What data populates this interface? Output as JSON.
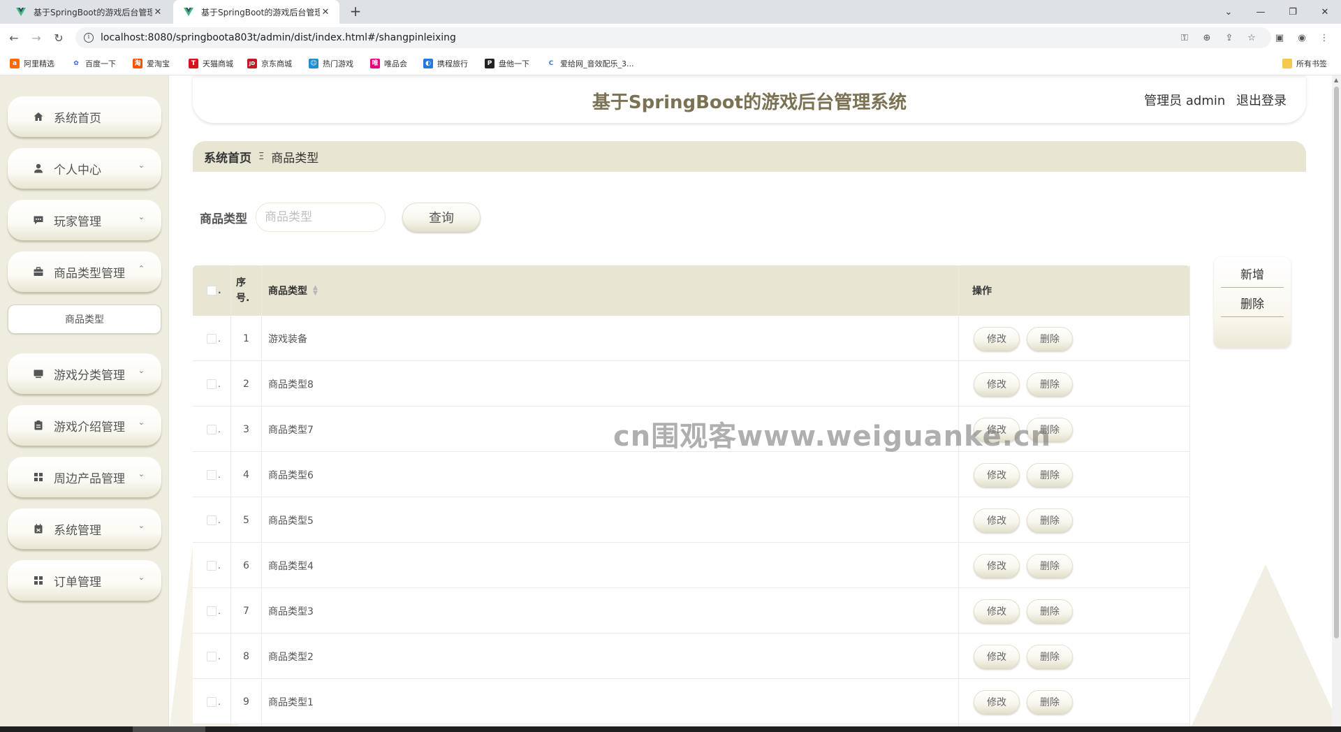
{
  "browser": {
    "tabs": [
      {
        "title": "基于SpringBoot的游戏后台管理",
        "active": false
      },
      {
        "title": "基于SpringBoot的游戏后台管理",
        "active": true
      }
    ],
    "url": "localhost:8080/springboota803t/admin/dist/index.html#/shangpinleixing",
    "bookmarks": [
      {
        "label": "阿里精选",
        "color": "#ff6a00",
        "glyph": "a"
      },
      {
        "label": "百度一下",
        "color": "#2e61d8",
        "glyph": "✿"
      },
      {
        "label": "爱淘宝",
        "color": "#ff5000",
        "glyph": "淘"
      },
      {
        "label": "天猫商城",
        "color": "#d8151a",
        "glyph": "T"
      },
      {
        "label": "京东商城",
        "color": "#c91623",
        "glyph": "JD"
      },
      {
        "label": "热门游戏",
        "color": "#1a8fd6",
        "glyph": "☺"
      },
      {
        "label": "唯品会",
        "color": "#e6007e",
        "glyph": "唯"
      },
      {
        "label": "携程旅行",
        "color": "#2577e3",
        "glyph": "◐"
      },
      {
        "label": "盘他一下",
        "color": "#222222",
        "glyph": "P"
      },
      {
        "label": "爱给网_音效配乐_3...",
        "color": "#2d7be5",
        "glyph": "C"
      }
    ],
    "all_bookmarks": "所有书签"
  },
  "sidebar": {
    "items": [
      {
        "label": "系统首页",
        "icon": "home-icon",
        "arrow": ""
      },
      {
        "label": "个人中心",
        "icon": "user-icon",
        "arrow": "⌄"
      },
      {
        "label": "玩家管理",
        "icon": "chat-icon",
        "arrow": "⌄"
      },
      {
        "label": "商品类型管理",
        "icon": "briefcase-icon",
        "arrow": "⌃"
      },
      {
        "label": "游戏分类管理",
        "icon": "monitor-icon",
        "arrow": "⌄"
      },
      {
        "label": "游戏介绍管理",
        "icon": "clipboard-icon",
        "arrow": "⌄"
      },
      {
        "label": "周边产品管理",
        "icon": "grid-icon",
        "arrow": "⌄"
      },
      {
        "label": "系统管理",
        "icon": "calendar-icon",
        "arrow": "⌄"
      },
      {
        "label": "订单管理",
        "icon": "grid-icon",
        "arrow": "⌄"
      }
    ],
    "subitem": "商品类型"
  },
  "header": {
    "title": "基于SpringBoot的游戏后台管理系统",
    "user": "管理员 admin",
    "logout": "退出登录"
  },
  "breadcrumb": {
    "home": "系统首页",
    "separator": "Ξ",
    "current": "商品类型"
  },
  "search": {
    "label": "商品类型",
    "placeholder": "商品类型",
    "button": "查询"
  },
  "actions": {
    "add": "新增",
    "delete": "删除"
  },
  "table": {
    "headers": {
      "index": "序号.",
      "type": "商品类型",
      "ops": "操作"
    },
    "rows": [
      {
        "index": "1",
        "type": "游戏装备"
      },
      {
        "index": "2",
        "type": "商品类型8"
      },
      {
        "index": "3",
        "type": "商品类型7"
      },
      {
        "index": "4",
        "type": "商品类型6"
      },
      {
        "index": "5",
        "type": "商品类型5"
      },
      {
        "index": "6",
        "type": "商品类型4"
      },
      {
        "index": "7",
        "type": "商品类型3"
      },
      {
        "index": "8",
        "type": "商品类型2"
      },
      {
        "index": "9",
        "type": "商品类型1"
      }
    ],
    "edit_label": "修改",
    "delete_label": "删除"
  },
  "watermark": "cn围观客www.weiguanke.cn",
  "colors": {
    "accent": "#7a7252",
    "header_bg": "#e8e5d3",
    "sidebar_bg": "#efeddf"
  }
}
